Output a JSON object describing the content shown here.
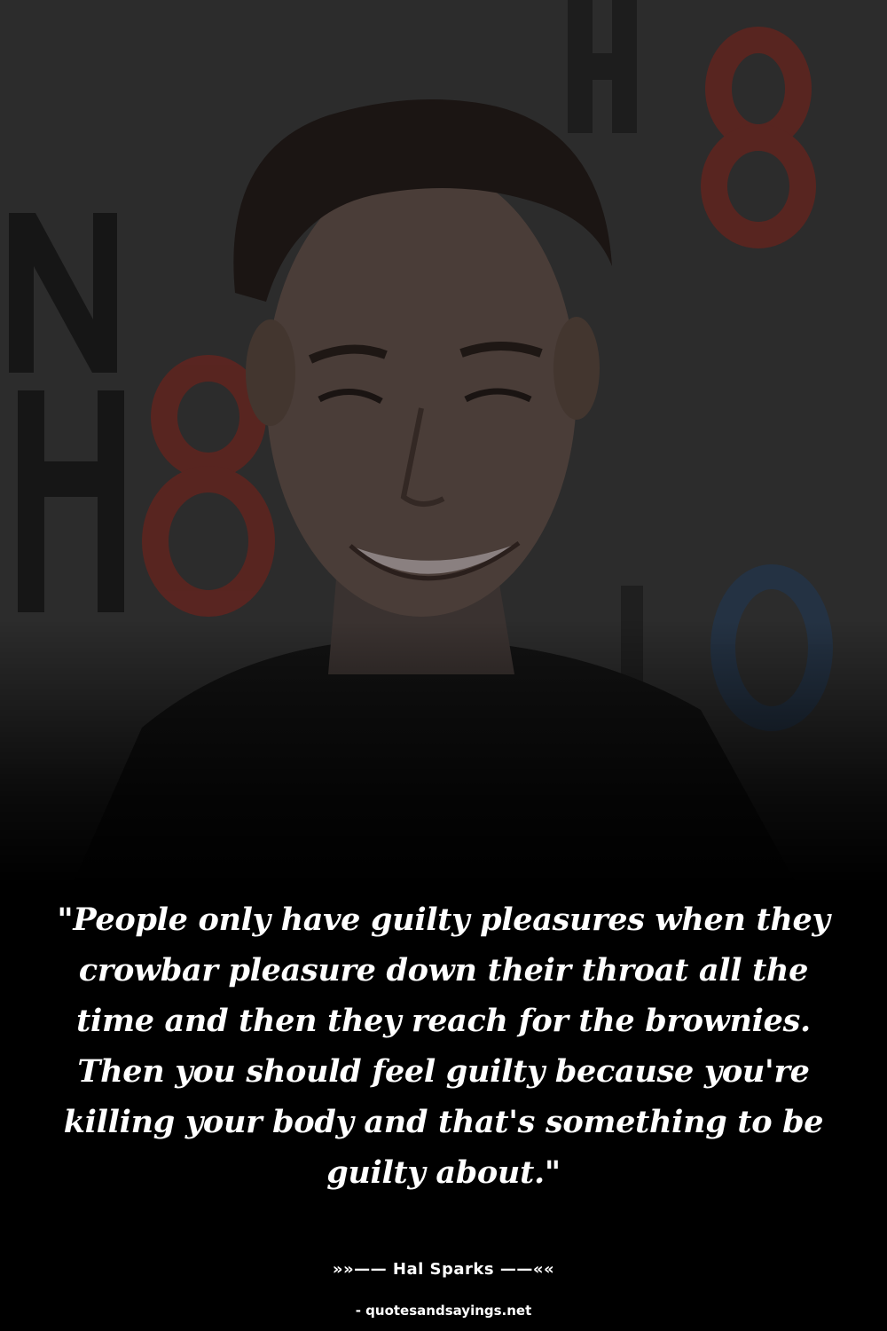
{
  "quote": {
    "text": "\"People only have guilty pleasures when they crowbar pleasure down their throat all the time and then they reach for the brownies. Then you should feel guilty because you're killing your body and that's something to be guilty about.\""
  },
  "author": {
    "line": "»»—— Hal Sparks ——««"
  },
  "source": {
    "line": "- quotesandsayings.net"
  },
  "background": {
    "backdrop_lettering": [
      "NO",
      "H8",
      "H8"
    ],
    "colors": {
      "page": "#000000",
      "backdrop": "#2f2f2f",
      "accent_red": "#6e2a24",
      "accent_blue": "#2b3a4a",
      "text": "#ffffff"
    }
  }
}
